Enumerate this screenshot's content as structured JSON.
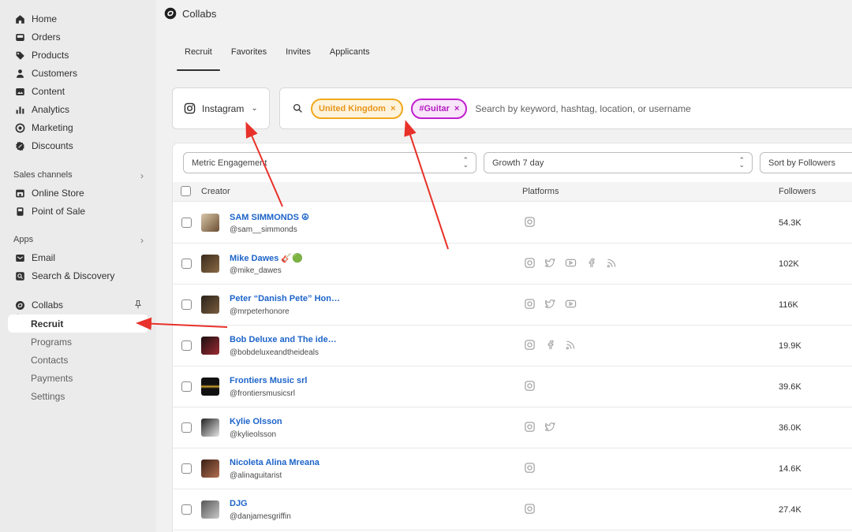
{
  "sidebar": {
    "nav": [
      {
        "label": "Home",
        "icon": "home-icon"
      },
      {
        "label": "Orders",
        "icon": "inbox-icon"
      },
      {
        "label": "Products",
        "icon": "tag-icon"
      },
      {
        "label": "Customers",
        "icon": "person-icon"
      },
      {
        "label": "Content",
        "icon": "image-icon"
      },
      {
        "label": "Analytics",
        "icon": "bar-chart-icon"
      },
      {
        "label": "Marketing",
        "icon": "target-icon"
      },
      {
        "label": "Discounts",
        "icon": "discount-icon"
      }
    ],
    "sales_channels_title": "Sales channels",
    "sales_channels": [
      {
        "label": "Online Store",
        "icon": "store-icon"
      },
      {
        "label": "Point of Sale",
        "icon": "pos-icon"
      }
    ],
    "apps_title": "Apps",
    "apps": [
      {
        "label": "Email",
        "icon": "email-icon"
      },
      {
        "label": "Search & Discovery",
        "icon": "search-discovery-icon"
      }
    ],
    "collabs_label": "Collabs",
    "collabs_sub": [
      "Recruit",
      "Programs",
      "Contacts",
      "Payments",
      "Settings"
    ]
  },
  "header": {
    "title": "Collabs"
  },
  "tabs": [
    "Recruit",
    "Favorites",
    "Invites",
    "Applicants"
  ],
  "filters": {
    "platform": "Instagram",
    "chips": [
      "United Kingdom",
      "#Guitar"
    ],
    "search_placeholder": "Search by keyword, hashtag, location, or username",
    "metric": "Metric Engagement",
    "growth": "Growth 7 day",
    "sort": "Sort by Followers"
  },
  "table": {
    "columns": [
      "Creator",
      "Platforms",
      "Followers"
    ],
    "rows": [
      {
        "name": "SAM SIMMONDS ☮",
        "handle": "@sam__simmonds",
        "followers": "54.3K",
        "platforms": [
          "instagram"
        ]
      },
      {
        "name": "Mike Dawes 🎸🟢",
        "handle": "@mike_dawes",
        "followers": "102K",
        "platforms": [
          "instagram",
          "twitter",
          "youtube",
          "facebook",
          "rss"
        ]
      },
      {
        "name": "Peter “Danish Pete” Hon…",
        "handle": "@mrpeterhonore",
        "followers": "116K",
        "platforms": [
          "instagram",
          "twitter",
          "youtube"
        ]
      },
      {
        "name": "Bob Deluxe and The ide…",
        "handle": "@bobdeluxeandtheideals",
        "followers": "19.9K",
        "platforms": [
          "instagram",
          "facebook",
          "rss"
        ]
      },
      {
        "name": "Frontiers Music srl",
        "handle": "@frontiersmusicsrl",
        "followers": "39.6K",
        "platforms": [
          "instagram"
        ]
      },
      {
        "name": "Kylie Olsson",
        "handle": "@kylieolsson",
        "followers": "36.0K",
        "platforms": [
          "instagram",
          "twitter"
        ]
      },
      {
        "name": "Nicoleta Alina Mreana",
        "handle": "@alinaguitarist",
        "followers": "14.6K",
        "platforms": [
          "instagram"
        ]
      },
      {
        "name": "DJG",
        "handle": "@danjamesgriffin",
        "followers": "27.4K",
        "platforms": [
          "instagram"
        ]
      }
    ]
  },
  "colors": {
    "link": "#1d64c9",
    "chip_orange": "#f0a91b",
    "chip_purple": "#c21ecf",
    "arrow": "#e8312a"
  }
}
